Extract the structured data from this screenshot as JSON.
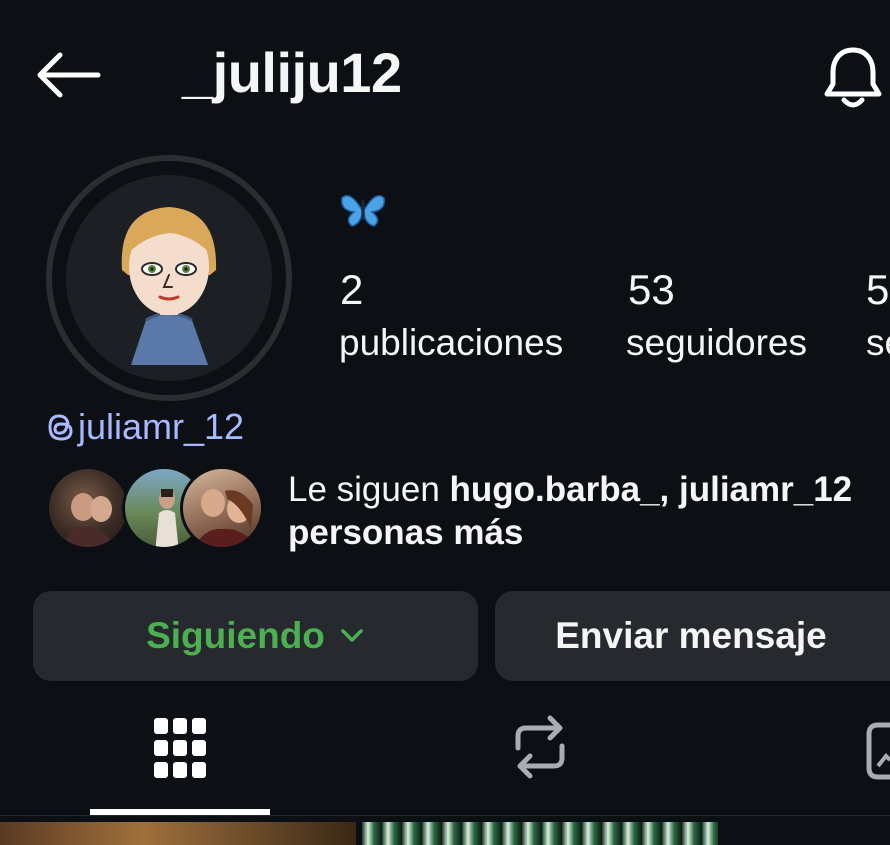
{
  "header": {
    "username": "_juliju12",
    "back_icon": "arrow-left-icon",
    "notifications_icon": "bell-icon"
  },
  "profile": {
    "avatar_icon": "memoji-avatar",
    "bio_emoji": "🦋",
    "stats": [
      {
        "count": "2",
        "label": "publicaciones"
      },
      {
        "count": "53",
        "label": "seguidores"
      },
      {
        "count": "5",
        "label": "se"
      }
    ],
    "threads_handle": "juliamr_12",
    "threads_icon": "threads-icon"
  },
  "mutual_followers": {
    "prefix": "Le siguen ",
    "names": "hugo.barba_, juliamr_12",
    "suffix": "personas más"
  },
  "actions": {
    "following_label": "Siguiendo",
    "message_label": "Enviar mensaje"
  },
  "tabs": [
    {
      "icon": "grid-icon",
      "active": true
    },
    {
      "icon": "repost-icon",
      "active": false
    },
    {
      "icon": "tagged-icon",
      "active": false
    }
  ],
  "colors": {
    "background": "#0c1014",
    "following_green": "#4caf50",
    "threads_link": "#a9b9ff",
    "button_bg": "#262a2f"
  }
}
